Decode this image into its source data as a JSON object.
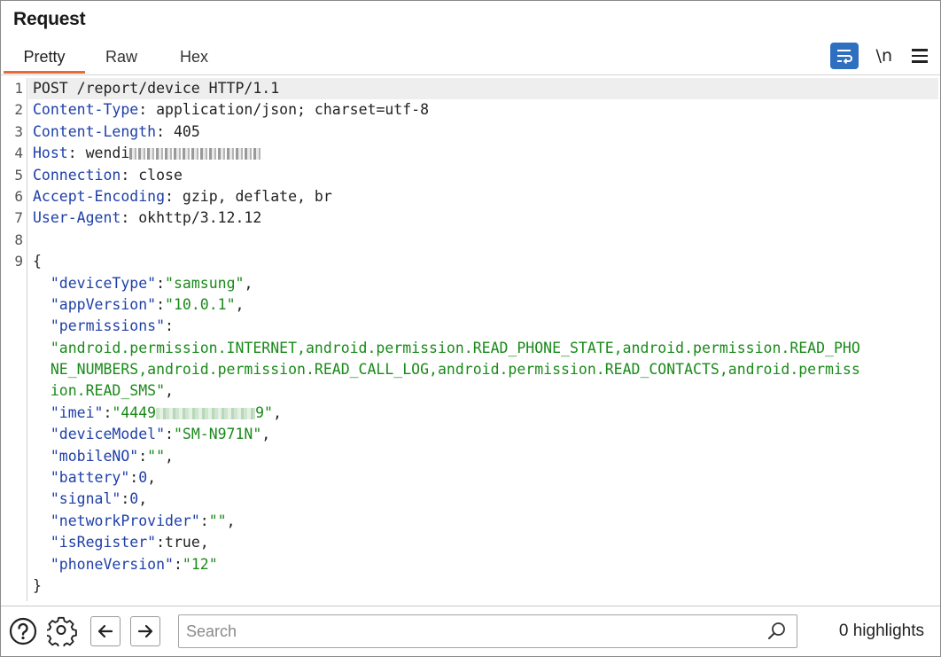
{
  "panel": {
    "title": "Request"
  },
  "tabs": [
    {
      "label": "Pretty",
      "active": true
    },
    {
      "label": "Raw",
      "active": false
    },
    {
      "label": "Hex",
      "active": false
    }
  ],
  "toolbar": {
    "wrap_icon": "word-wrap-icon",
    "newline_label": "\\n",
    "menu_icon": "hamburger-menu-icon",
    "accent": "#2f6fbf",
    "tab_accent": "#e8693a"
  },
  "editor": {
    "line_numbers": [
      "1",
      "2",
      "3",
      "4",
      "5",
      "6",
      "7",
      "8",
      "9"
    ],
    "request_line": "POST /report/device HTTP/1.1",
    "headers": [
      {
        "name": "Content-Type",
        "value": "application/json; charset=utf-8"
      },
      {
        "name": "Content-Length",
        "value": "405"
      },
      {
        "name": "Host",
        "value": "wendi"
      },
      {
        "name": "Connection",
        "value": "close"
      },
      {
        "name": "Accept-Encoding",
        "value": "gzip, deflate, br"
      },
      {
        "name": "User-Agent",
        "value": "okhttp/3.12.12"
      }
    ],
    "body": {
      "open": "{",
      "close": "}",
      "deviceType_key": "\"deviceType\"",
      "deviceType_val": "\"samsung\"",
      "appVersion_key": "\"appVersion\"",
      "appVersion_val": "\"10.0.1\"",
      "permissions_key": "\"permissions\"",
      "permissions_l1": "\"android.permission.INTERNET,android.permission.READ_PHONE_STATE,android.permission.READ_PHO",
      "permissions_l2": "NE_NUMBERS,android.permission.READ_CALL_LOG,android.permission.READ_CONTACTS,android.permiss",
      "permissions_l3": "ion.READ_SMS\"",
      "imei_key": "\"imei\"",
      "imei_val_start": "\"4449",
      "imei_val_end": "9\"",
      "deviceModel_key": "\"deviceModel\"",
      "deviceModel_val": "\"SM-N971N\"",
      "mobileNO_key": "\"mobileNO\"",
      "mobileNO_val": "\"\"",
      "battery_key": "\"battery\"",
      "battery_val": "0",
      "signal_key": "\"signal\"",
      "signal_val": "0",
      "networkProvider_key": "\"networkProvider\"",
      "networkProvider_val": "\"\"",
      "isRegister_key": "\"isRegister\"",
      "isRegister_val": "true",
      "phoneVersion_key": "\"phoneVersion\"",
      "phoneVersion_val": "\"12\""
    }
  },
  "bottombar": {
    "help_icon": "help-circle-icon",
    "settings_icon": "gear-icon",
    "back_icon": "arrow-left-icon",
    "forward_icon": "arrow-right-icon",
    "search_placeholder": "Search",
    "search_value": "",
    "highlights": "0 highlights"
  }
}
